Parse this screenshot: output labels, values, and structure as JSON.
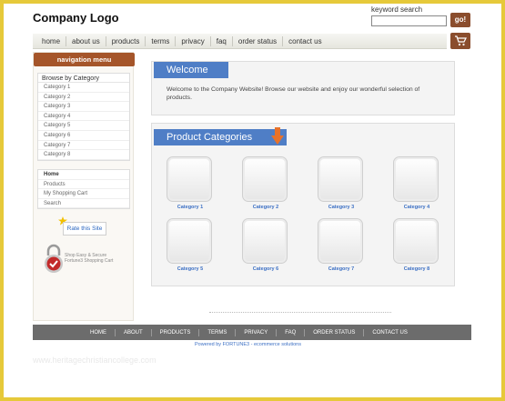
{
  "header": {
    "logo": "Company Logo",
    "search_label": "keyword search",
    "search_value": "",
    "go_label": "go!"
  },
  "topnav": [
    "home",
    "about us",
    "products",
    "terms",
    "privacy",
    "faq",
    "order status",
    "contact us"
  ],
  "sidebar": {
    "nav_title": "navigation menu",
    "browse_title": "Browse by Category",
    "categories": [
      "Category 1",
      "Category 2",
      "Category 3",
      "Category 4",
      "Category 5",
      "Category 6",
      "Category 7",
      "Category 8"
    ],
    "links": [
      "Home",
      "Products",
      "My Shopping Cart",
      "Search"
    ],
    "rate_label": "Rate this Site",
    "secure_text": [
      "Shop Easy & Secure",
      "Fortune3 Shopping Cart"
    ]
  },
  "welcome": {
    "title": "Welcome",
    "text": "Welcome to the Company Website! Browse our website and enjoy our wonderful selection of products."
  },
  "product_categories": {
    "title": "Product Categories",
    "items": [
      "Category 1",
      "Category 2",
      "Category 3",
      "Category 4",
      "Category 5",
      "Category 6",
      "Category 7",
      "Category 8"
    ]
  },
  "footer": {
    "links": [
      "HOME",
      "ABOUT",
      "PRODUCTS",
      "TERMS",
      "PRIVACY",
      "FAQ",
      "ORDER STATUS",
      "CONTACT US"
    ],
    "powered_by": "Powered by FORTUNE3 - ecommerce solutions"
  },
  "watermark": "www.heritagechristiancollege.com",
  "colors": {
    "accent_brown": "#8a4d2d",
    "title_blue": "#4f7ec6",
    "frame_gold": "#e6c93a"
  }
}
